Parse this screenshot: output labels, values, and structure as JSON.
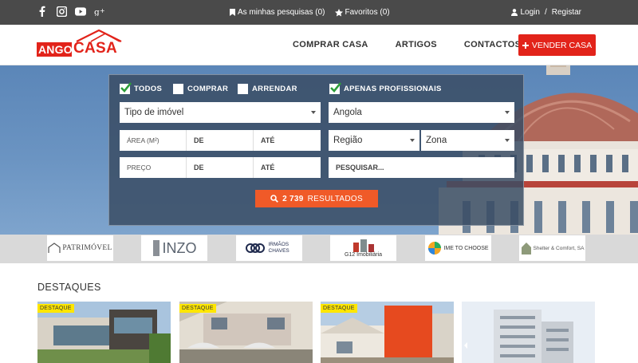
{
  "topbar": {
    "social_icons": [
      "facebook-icon",
      "instagram-icon",
      "youtube-icon",
      "google-plus-icon"
    ],
    "my_searches": "As minhas pesquisas (0)",
    "favorites": "Favoritos (0)",
    "login": "Login",
    "separator": "/",
    "register": "Registar"
  },
  "nav": {
    "logo_left": "ANGO",
    "logo_right": "CASA",
    "menu": [
      "COMPRAR CASA",
      "ARTIGOS",
      "CONTACTOS"
    ],
    "sell_button": "VENDER CASA"
  },
  "search": {
    "filters": [
      {
        "label": "TODOS",
        "checked": true
      },
      {
        "label": "COMPRAR",
        "checked": false
      },
      {
        "label": "ARRENDAR",
        "checked": false
      },
      {
        "label": "APENAS PROFISSIONAIS",
        "checked": true
      }
    ],
    "property_type": "Tipo de imóvel",
    "country": "Angola",
    "area_label": "ÁREA (M²)",
    "area_from": "DE",
    "area_to": "ATÉ",
    "region": "Região",
    "zone": "Zona",
    "price_label": "PREÇO",
    "price_from": "DE",
    "price_to": "ATÉ",
    "keyword_placeholder": "PESQUISAR...",
    "results_count": "2 739",
    "results_label": "RESULTADOS"
  },
  "partners": [
    "PATRIMÓVEL",
    "INZO",
    "IRMÃOS CHAVES",
    "G12 Imobiliária",
    "IME TO CHOOSE",
    "Shelter & Comfort, SA"
  ],
  "featured": {
    "title": "DESTAQUES",
    "badge": "DESTAQUE"
  },
  "colors": {
    "brand_red": "#e2231a",
    "results_orange": "#f05a28",
    "badge_yellow": "#ffe600",
    "topbar": "#4a4a4a"
  }
}
